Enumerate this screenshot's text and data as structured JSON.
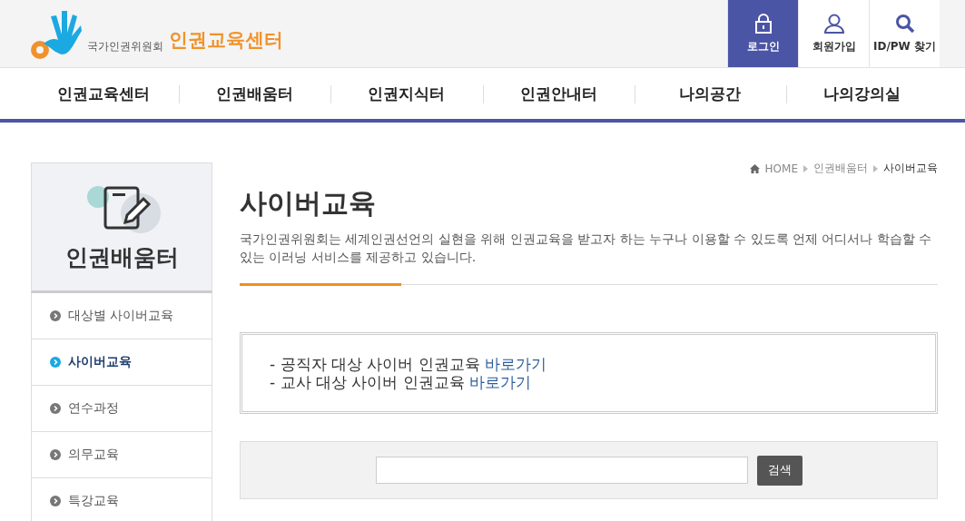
{
  "header": {
    "org": "국가인권위원회",
    "brand": "인권교육센터",
    "utility": [
      {
        "label": "로그인",
        "kind": "lock"
      },
      {
        "label": "회원가입",
        "kind": "person"
      },
      {
        "label": "ID/PW 찾기",
        "kind": "search"
      }
    ]
  },
  "nav": [
    "인권교육센터",
    "인권배움터",
    "인권지식터",
    "인권안내터",
    "나의공간",
    "나의강의실"
  ],
  "sidebar": {
    "title": "인권배움터",
    "items": [
      {
        "label": "대상별 사이버교육",
        "selected": false
      },
      {
        "label": "사이버교육",
        "selected": true
      },
      {
        "label": "연수과정",
        "selected": false
      },
      {
        "label": "의무교육",
        "selected": false
      },
      {
        "label": "특강교육",
        "selected": false
      }
    ]
  },
  "breadcrumb": [
    "HOME",
    "인권배움터",
    "사이버교육"
  ],
  "page": {
    "title": "사이버교육",
    "intro": "국가인권위원회는 세계인권선언의 실현을 위해 인권교육을 받고자 하는 누구나 이용할 수 있도록 언제 어디서나 학습할 수 있는 이러닝 서비스를 제공하고 있습니다.",
    "notices": [
      {
        "text": "- 공직자 대상 사이버 인권교육",
        "link": "바로가기"
      },
      {
        "text": "- 교사 대상 사이버 인권교육",
        "link": "바로가기"
      }
    ],
    "search": {
      "button": "검색"
    }
  }
}
